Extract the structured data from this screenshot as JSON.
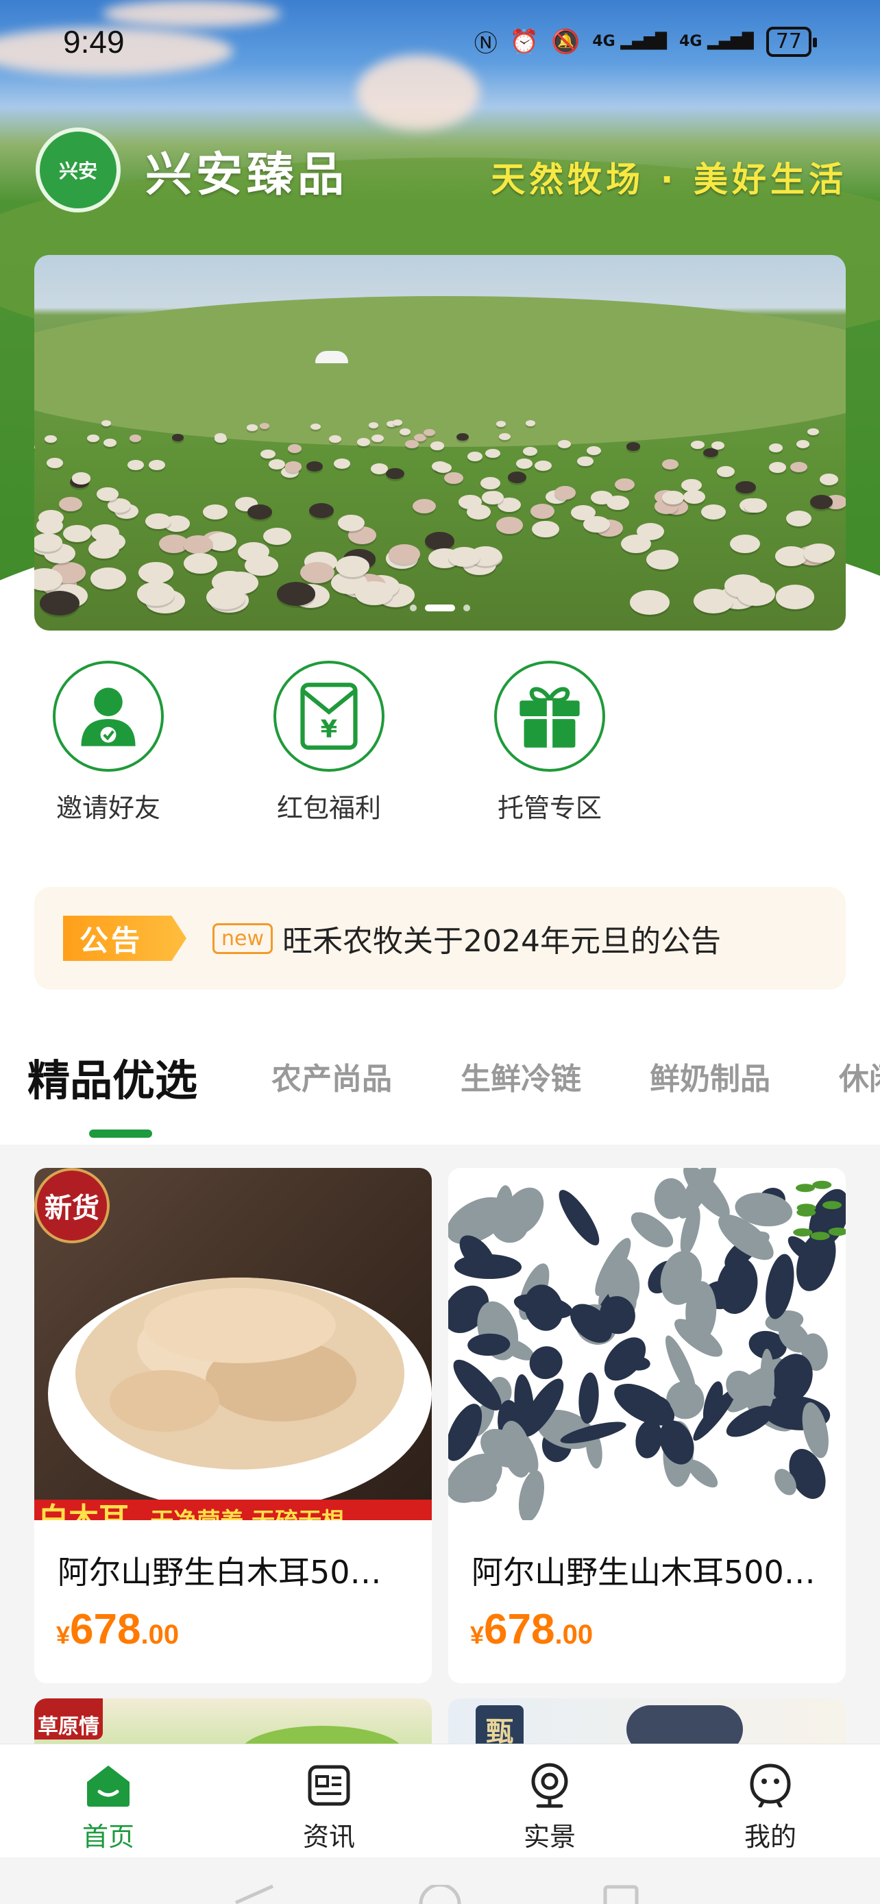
{
  "status_bar": {
    "time": "9:49",
    "signal1": "4G",
    "signal2": "4G",
    "battery": "77"
  },
  "header": {
    "brand_name": "兴安臻品",
    "logo_text": "兴安",
    "slogan": "天然牧场 · 美好生活"
  },
  "banner": {
    "slide_count": 3,
    "active_index": 1
  },
  "quick_entries": [
    {
      "label": "邀请好友",
      "icon": "invite-user-icon"
    },
    {
      "label": "红包福利",
      "icon": "red-envelope-icon"
    },
    {
      "label": "托管专区",
      "icon": "gift-icon"
    }
  ],
  "notice": {
    "tag": "公告",
    "new_badge": "new",
    "text": "旺禾农牧关于2024年元旦的公告"
  },
  "category_tabs": [
    {
      "label": "精品优选",
      "active": true
    },
    {
      "label": "农产尚品",
      "active": false
    },
    {
      "label": "生鲜冷链",
      "active": false
    },
    {
      "label": "鲜奶制品",
      "active": false
    },
    {
      "label": "休闲",
      "active": false
    }
  ],
  "products": [
    {
      "title": "阿尔山野生白木耳50…",
      "price_symbol": "¥",
      "price_int": "678",
      "price_dec": ".00",
      "badge": "新货",
      "banner_text": "白木耳",
      "banner_sub": "干净营养 无硫无根"
    },
    {
      "title": "阿尔山野生山木耳500…",
      "price_symbol": "¥",
      "price_int": "678",
      "price_dec": ".00"
    }
  ],
  "peek_cards": [
    {
      "label": "草原情"
    },
    {
      "label": "甄"
    }
  ],
  "bottom_nav": [
    {
      "label": "首页",
      "icon": "home-icon",
      "active": true
    },
    {
      "label": "资讯",
      "icon": "news-icon",
      "active": false
    },
    {
      "label": "实景",
      "icon": "camera-icon",
      "active": false
    },
    {
      "label": "我的",
      "icon": "profile-icon",
      "active": false
    }
  ],
  "colors": {
    "brand_green": "#1c9a3d",
    "price_orange": "#ff7a00",
    "slogan_yellow": "#f7e843",
    "notice_orange": "#ff9f1a"
  }
}
